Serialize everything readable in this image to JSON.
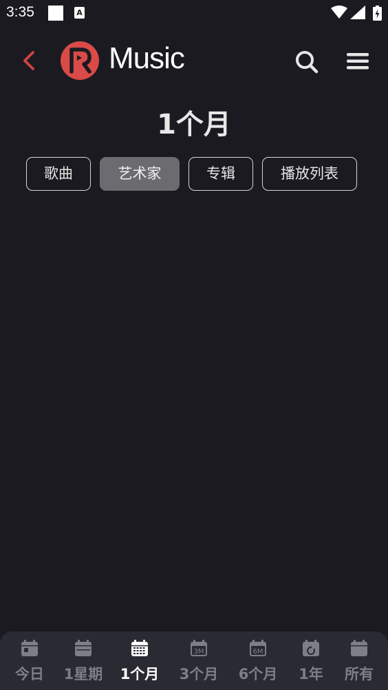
{
  "status_bar": {
    "time": "3:35",
    "icons": [
      "square-icon",
      "a-notification-icon",
      "wifi-icon",
      "signal-icon",
      "battery-icon"
    ],
    "a_letter": "A"
  },
  "header": {
    "app_name": "Music",
    "logo_color": "#d94a48",
    "back_color": "#c94240"
  },
  "page": {
    "title": "1个月"
  },
  "tabs": [
    {
      "label": "歌曲",
      "active": false
    },
    {
      "label": "艺术家",
      "active": true
    },
    {
      "label": "专辑",
      "active": false
    },
    {
      "label": "播放列表",
      "active": false
    }
  ],
  "bottom_nav": {
    "items": [
      {
        "label": "今日",
        "icon": "calendar-day-icon",
        "active": false
      },
      {
        "label": "1星期",
        "icon": "calendar-week-icon",
        "active": false
      },
      {
        "label": "1个月",
        "icon": "calendar-month-icon",
        "active": true
      },
      {
        "label": "3个月",
        "icon": "calendar-3m-icon",
        "active": false,
        "icon_text": "3M"
      },
      {
        "label": "6个月",
        "icon": "calendar-6m-icon",
        "active": false,
        "icon_text": "6M"
      },
      {
        "label": "1年",
        "icon": "calendar-year-icon",
        "active": false
      },
      {
        "label": "所有",
        "icon": "calendar-all-icon",
        "active": false
      }
    ]
  },
  "colors": {
    "background": "#1a1a20",
    "nav_background": "#2a2a33",
    "active_tab": "#6c6c70",
    "inactive_nav_label": "#7e7e86"
  }
}
